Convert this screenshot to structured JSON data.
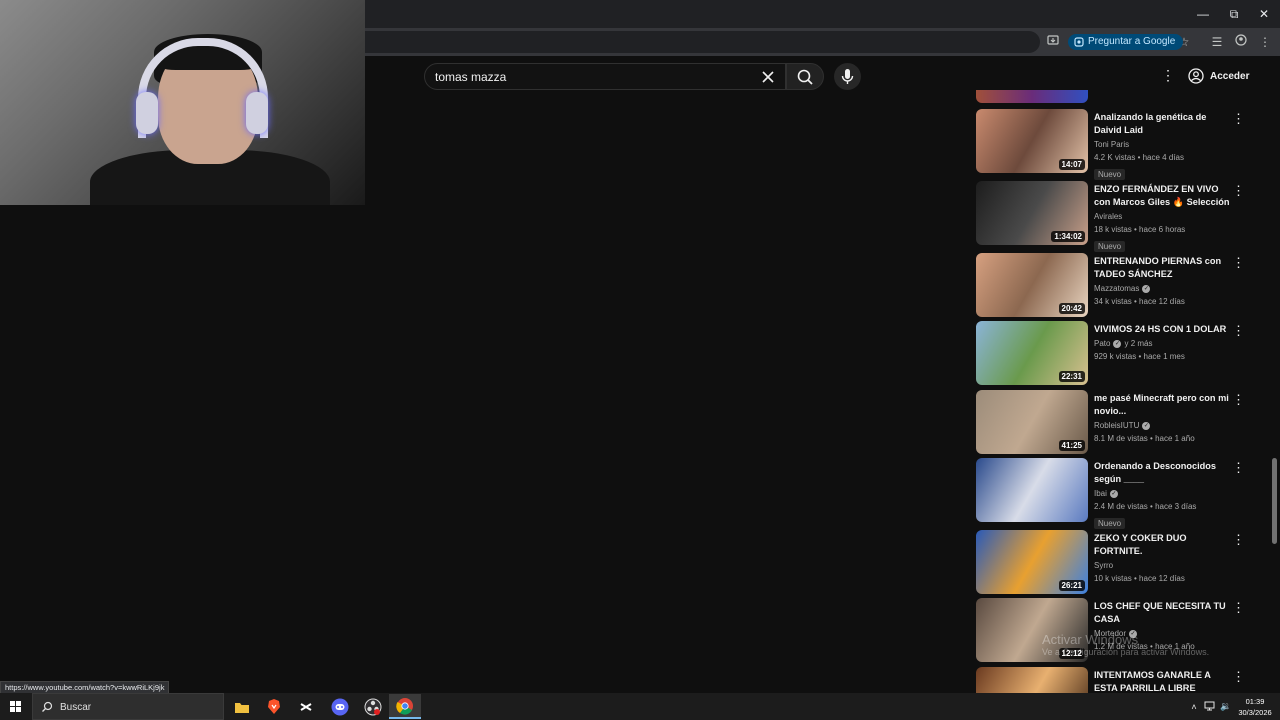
{
  "browser": {
    "ask_google_label": "Preguntar a Google",
    "status_url": "https://www.youtube.com/watch?v=kwwRiLKj9jk",
    "window_buttons": [
      "minimize-icon",
      "restore-icon",
      "close-icon"
    ]
  },
  "youtube": {
    "search": {
      "value": "tomas mazza"
    },
    "signin_label": "Acceder"
  },
  "videos": [
    {
      "title": "Analizando la genética de Daivid Laid",
      "channel": "Toni Paris",
      "verified": false,
      "views": "4.2 K vistas",
      "age": "hace 4 días",
      "duration": "14:07",
      "badge": "Nuevo",
      "thumb_colors": [
        "#c98a6e",
        "#6d4a3c",
        "#e2c2a8"
      ]
    },
    {
      "title": "ENZO FERNÁNDEZ EN VIVO con Marcos Giles 🔥 Selección ...",
      "channel": "Avirales",
      "verified": false,
      "views": "18 k vistas",
      "age": "hace 6 horas",
      "duration": "1:34:02",
      "badge": "Nuevo",
      "thumb_colors": [
        "#1d1d1d",
        "#4a4a4a",
        "#c9a08a"
      ]
    },
    {
      "title": "ENTRENANDO PIERNAS con TADEO SÁNCHEZ",
      "channel": "Mazzatomas",
      "verified": true,
      "views": "34 k vistas",
      "age": "hace 12 días",
      "duration": "20:42",
      "badge": "",
      "thumb_colors": [
        "#d6a080",
        "#8c6850",
        "#e8d4c0"
      ]
    },
    {
      "title": "VIVIMOS 24 HS CON 1 DOLAR",
      "channel": "Pato",
      "verified": true,
      "channel_extra": "y 2 más",
      "views": "929 k vistas",
      "age": "hace 1 mes",
      "duration": "22:31",
      "badge": "",
      "thumb_colors": [
        "#8bb4d8",
        "#6a9a4c",
        "#d8c090"
      ]
    },
    {
      "title": "me pasé Minecraft pero con mi novio...",
      "channel": "RobleisIUTU",
      "verified": true,
      "views": "8.1 M de vistas",
      "age": "hace 1 año",
      "duration": "41:25",
      "badge": "",
      "thumb_colors": [
        "#9c8c7a",
        "#c0a890",
        "#6a5a4a"
      ]
    },
    {
      "title": "Ordenando a Desconocidos según ____",
      "channel": "Ibai",
      "verified": true,
      "views": "2.4 M de vistas",
      "age": "hace 3 días",
      "duration": "",
      "badge": "Nuevo",
      "thumb_colors": [
        "#2a4a8c",
        "#d8dce8",
        "#5a7ac0"
      ]
    },
    {
      "title": "ZEKO Y COKER DUO FORTNITE.",
      "channel": "Syrro",
      "verified": false,
      "views": "10 k vistas",
      "age": "hace 12 días",
      "duration": "26:21",
      "badge": "",
      "thumb_colors": [
        "#2a5ab8",
        "#e8a030",
        "#3c80e0"
      ]
    },
    {
      "title": "LOS CHEF QUE NECESITA TU CASA",
      "channel": "Mortedor",
      "verified": true,
      "views": "1.2 M de vistas",
      "age": "hace 1 año",
      "duration": "12:12",
      "badge": "",
      "thumb_colors": [
        "#5a4a40",
        "#c0a890",
        "#2a2a2a"
      ]
    },
    {
      "title": "INTENTAMOS GANARLE A ESTA PARRILLA LIBRE",
      "channel": "",
      "verified": false,
      "views": "",
      "age": "",
      "duration": "",
      "badge": "",
      "thumb_colors": [
        "#6a3a20",
        "#e8b070",
        "#3a2010"
      ]
    }
  ],
  "watermark": {
    "line1": "Activar Windows",
    "line2": "Ve a Configuración para activar Windows."
  },
  "taskbar": {
    "search_label": "Buscar",
    "time": "01:39",
    "date": "30/3/2026"
  }
}
